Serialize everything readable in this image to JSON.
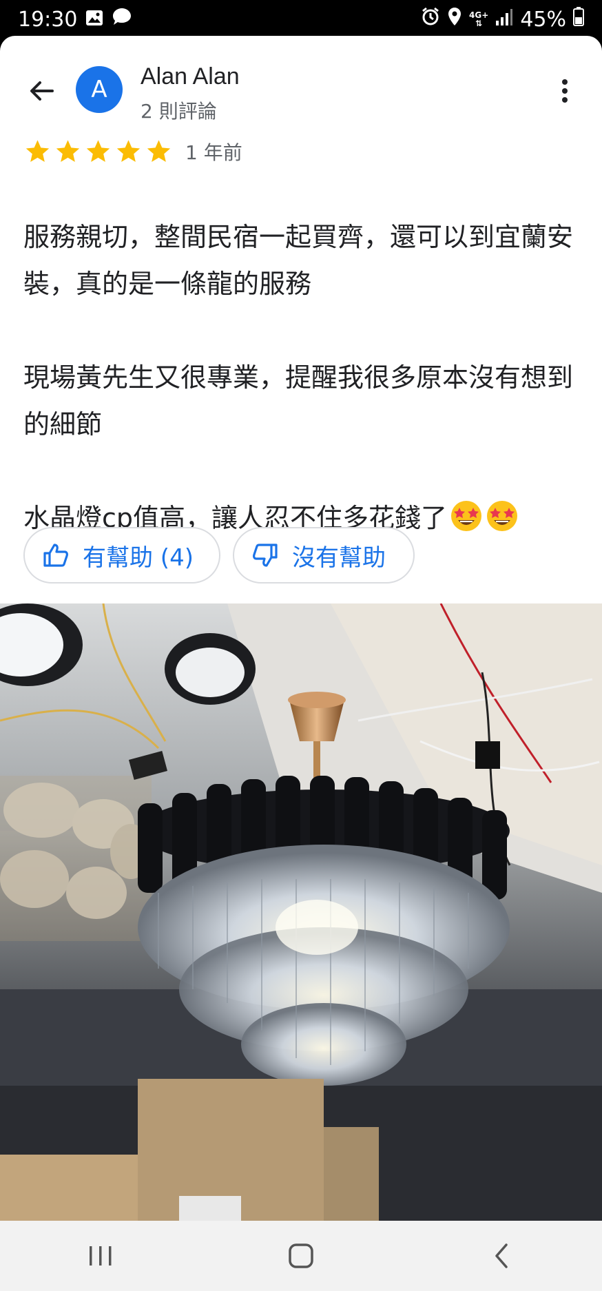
{
  "status_bar": {
    "time": "19:30",
    "network_top": "4G+",
    "battery": "45%",
    "icons": [
      "gallery-icon",
      "chat-icon",
      "alarm-icon",
      "location-icon",
      "signal-icon",
      "battery-icon"
    ]
  },
  "review": {
    "avatar_letter": "A",
    "author": "Alan Alan",
    "review_count": "2 則評論",
    "rating": 5,
    "rating_max": 5,
    "date": "1 年前",
    "paragraphs": [
      "服務親切，整間民宿一起買齊，還可以到宜蘭安裝，真的是一條龍的服務",
      "現場黃先生又很專業，提醒我很多原本沒有想到的細節",
      "水晶燈cp值高，讓人忍不住多花錢了"
    ],
    "emojis": [
      "star-struck-emoji",
      "star-struck-emoji"
    ],
    "helpful_label": "有幫助 (4)",
    "not_helpful_label": "沒有幫助"
  },
  "colors": {
    "accent": "#1a73e8",
    "star": "#fbbc04",
    "text_primary": "#202124",
    "text_secondary": "#5f6368"
  },
  "photo": {
    "subject": "crystal-chandelier-photo"
  },
  "nav": [
    "recent-apps-icon",
    "home-icon",
    "back-icon"
  ]
}
